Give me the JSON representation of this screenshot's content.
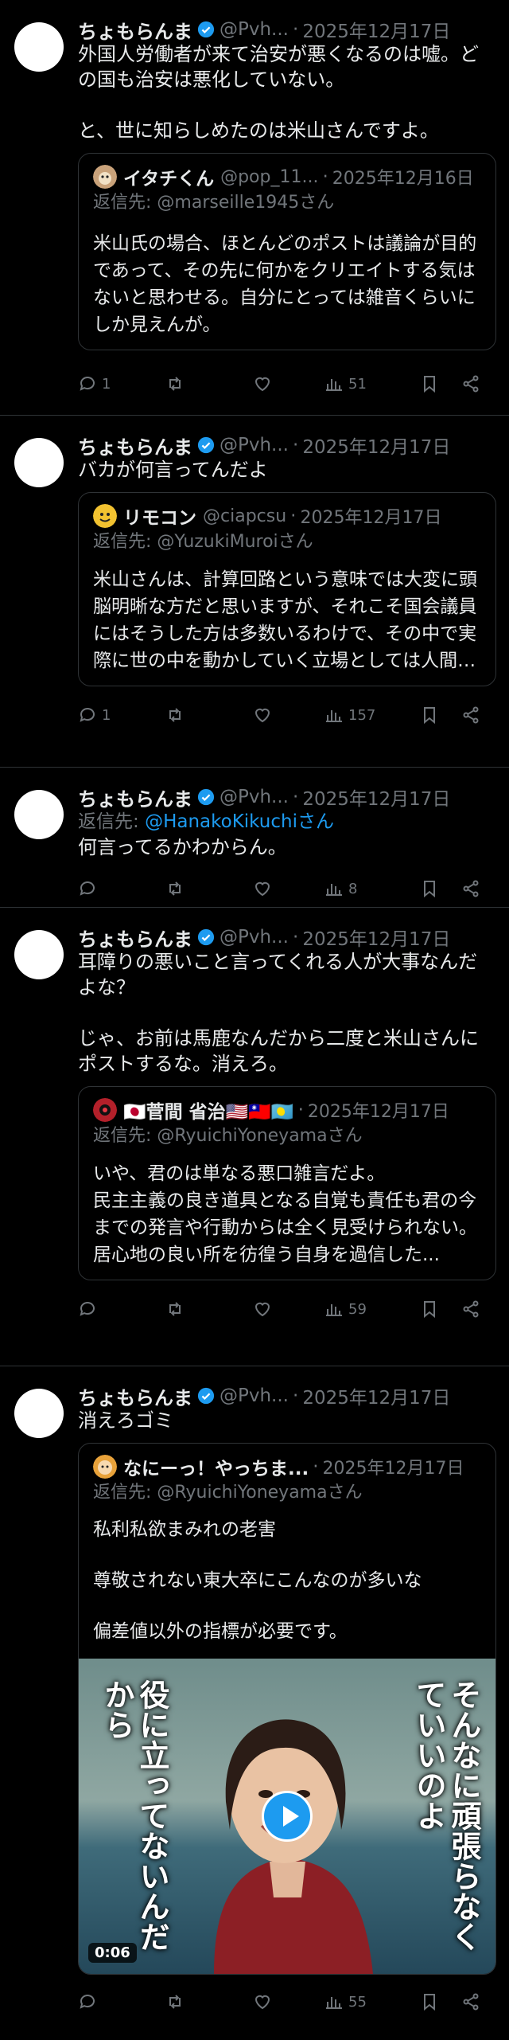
{
  "colors": {
    "accent": "#1d9bf0",
    "muted": "#71767b",
    "text": "#e7e9ea",
    "border": "#2f3336",
    "background": "#000000"
  },
  "tweets": [
    {
      "author_name": "ちょもらんま",
      "author_handle": "@Pvh...",
      "date": "2025年12月17日",
      "text": "外国人労働者が来て治安が悪くなるのは嘘。どの国も治安は悪化していない。\n\nと、世に知らしめたのは米山さんですよ。",
      "quote": {
        "name": "イタチくん",
        "handle": "@pop_11...",
        "date": "2025年12月16日",
        "reply_to": "返信先: @marseille1945さん",
        "text": "米山氏の場合、ほとんどのポストは議論が目的であって、その先に何かをクリエイトする気はないと思わせる。自分にとっては雑音くらいにしか見えんが。"
      },
      "replies": "1",
      "views": "51"
    },
    {
      "author_name": "ちょもらんま",
      "author_handle": "@Pvh...",
      "date": "2025年12月17日",
      "text": "バカが何言ってんだよ",
      "quote": {
        "name": "リモコン",
        "handle": "@ciapcsu",
        "date": "2025年12月17日",
        "reply_to": "返信先: @YuzukiMuroiさん",
        "text": "米山さんは、計算回路という意味では大変に頭脳明晰な方だと思いますが、それこそ国会議員にはそうした方は多数いるわけで、その中で実際に世の中を動かしていく立場としては人間性やバランス感覚の部..."
      },
      "replies": "1",
      "views": "157"
    },
    {
      "author_name": "ちょもらんま",
      "author_handle": "@Pvh...",
      "date": "2025年12月17日",
      "reply_prefix": "返信先: ",
      "reply_link": "@HanakoKikuchiさん",
      "text": "何言ってるかわからん。",
      "views": "8"
    },
    {
      "author_name": "ちょもらんま",
      "author_handle": "@Pvh...",
      "date": "2025年12月17日",
      "text": "耳障りの悪いこと言ってくれる人が大事なんだよな？\n\nじゃ、お前は馬鹿なんだから二度と米山さんにポストするな。消えろ。",
      "quote": {
        "name": "🇯🇵菅間 省治🇺🇸🇹🇼🇵🇼",
        "date": "2025年12月17日",
        "reply_to": "返信先: @RyuichiYoneyamaさん",
        "text": "いや、君のは単なる悪口雑言だよ。\n民主主義の良き道具となる自覚も責任も君の今までの発言や行動からは全く見受けられない。\n居心地の良い所を彷徨う自身を過信した..."
      },
      "views": "59"
    },
    {
      "author_name": "ちょもらんま",
      "author_handle": "@Pvh...",
      "date": "2025年12月17日",
      "text": "消えろゴミ",
      "quote": {
        "name": "なにーっ！やっちま...",
        "date": "2025年12月17日",
        "reply_to": "返信先: @RyuichiYoneyamaさん",
        "text": "私利私欲まみれの老害\n\n尊敬されない東大卒にこんなのが多いな\n\n偏差値以外の指標が必要です。",
        "video": {
          "caption_right": "そんなに頑張らなくていいのよ",
          "caption_left": "役に立ってないんだから",
          "duration": "0:06"
        }
      },
      "views": "55"
    }
  ]
}
